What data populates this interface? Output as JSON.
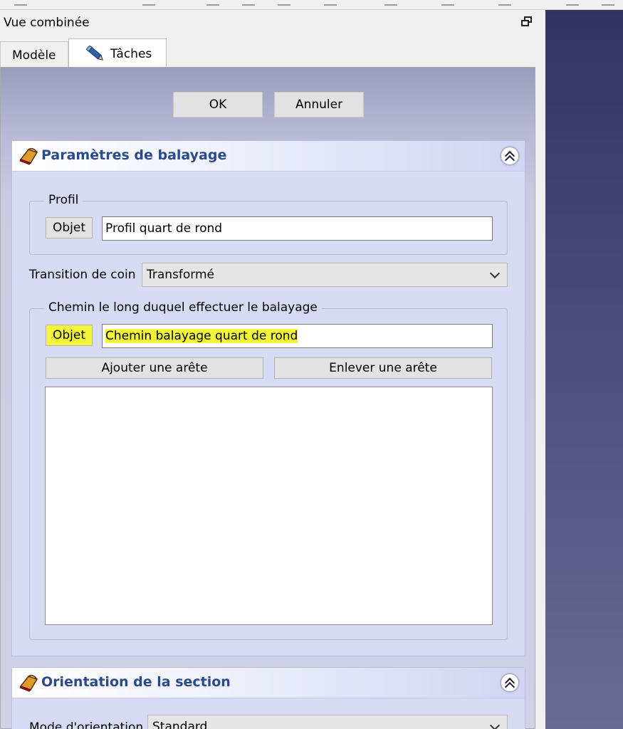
{
  "panel": {
    "title": "Vue combinée",
    "tabs": [
      {
        "label": "Modèle"
      },
      {
        "label": "Tâches"
      }
    ]
  },
  "dialog": {
    "ok_label": "OK",
    "cancel_label": "Annuler"
  },
  "sweep_params": {
    "title": "Paramètres de balayage",
    "profile_group": {
      "title": "Profil",
      "object_button": "Objet",
      "value": "Profil quart de rond"
    },
    "corner_transition": {
      "label": "Transition de coin",
      "selected": "Transformé"
    },
    "path_group": {
      "title": "Chemin le long duquel effectuer le balayage",
      "object_button": "Objet",
      "value": "Chemin balayage quart de rond",
      "add_edge_label": "Ajouter une arête",
      "remove_edge_label": "Enlever une arête"
    }
  },
  "section_orientation": {
    "title": "Orientation de la section",
    "mode_label": "Mode d'orientation",
    "mode_selected": "Standard"
  },
  "colors": {
    "highlight": "#f4f53a",
    "section_title": "#2a4a8a",
    "viewport_top": "#33335f",
    "viewport_bottom": "#6a6a94"
  },
  "icons": {
    "float": "window-float-icon",
    "tasks_tab": "pencil-icon",
    "section": "sweep-icon",
    "collapse": "chevron-double-up-icon"
  }
}
